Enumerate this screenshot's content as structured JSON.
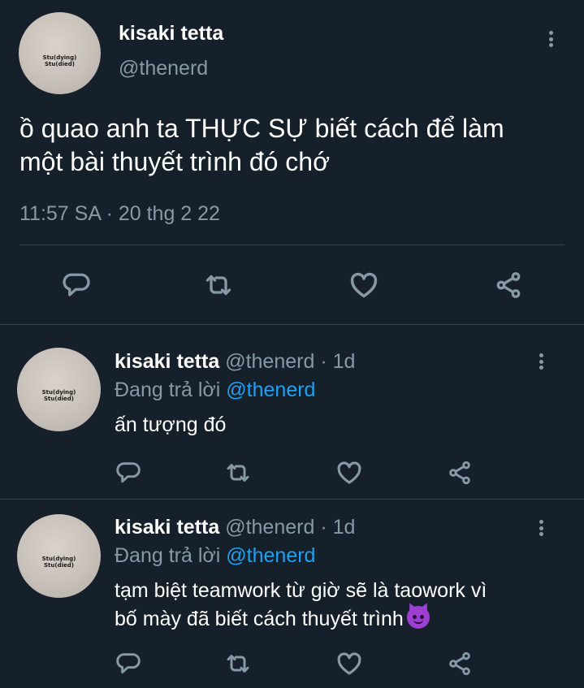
{
  "main_tweet": {
    "name": "kisaki tetta",
    "handle": "@thenerd",
    "avatar_text": [
      "Stu(dying)",
      "Stu(died)"
    ],
    "text_line1": "ồ quao anh ta THỰC SỰ biết cách để làm",
    "text_line2": "một bài thuyết trình đó chớ",
    "meta": "11:57 SA · 20 thg 2 22",
    "actions": [
      "reply-icon",
      "retweet-icon",
      "like-icon",
      "share-icon"
    ]
  },
  "replies": [
    {
      "name": "kisaki tetta",
      "handle": "@thenerd",
      "dot": "·",
      "time": "1d",
      "replying_prefix": "Đang trả lời",
      "replying_to": "@thenerd",
      "text_line1": "ấn tượng đó",
      "text_line2": "",
      "avatar_text": [
        "Stu(dying)",
        "Stu(died)"
      ]
    },
    {
      "name": "kisaki tetta",
      "handle": "@thenerd",
      "dot": "·",
      "time": "1d",
      "replying_prefix": "Đang trả lời",
      "replying_to": "@thenerd",
      "text_line1": "tạm biệt teamwork từ giờ sẽ là taowork vì",
      "text_line2": "bố mày đã biết cách thuyết trình",
      "emoji": "smiling-imp-emoji",
      "avatar_text": [
        "Stu(dying)",
        "Stu(died)"
      ]
    }
  ],
  "colors": {
    "background": "#15202b",
    "secondary_text": "#8899a6",
    "link": "#1da1f2",
    "divider": "#38444d"
  }
}
